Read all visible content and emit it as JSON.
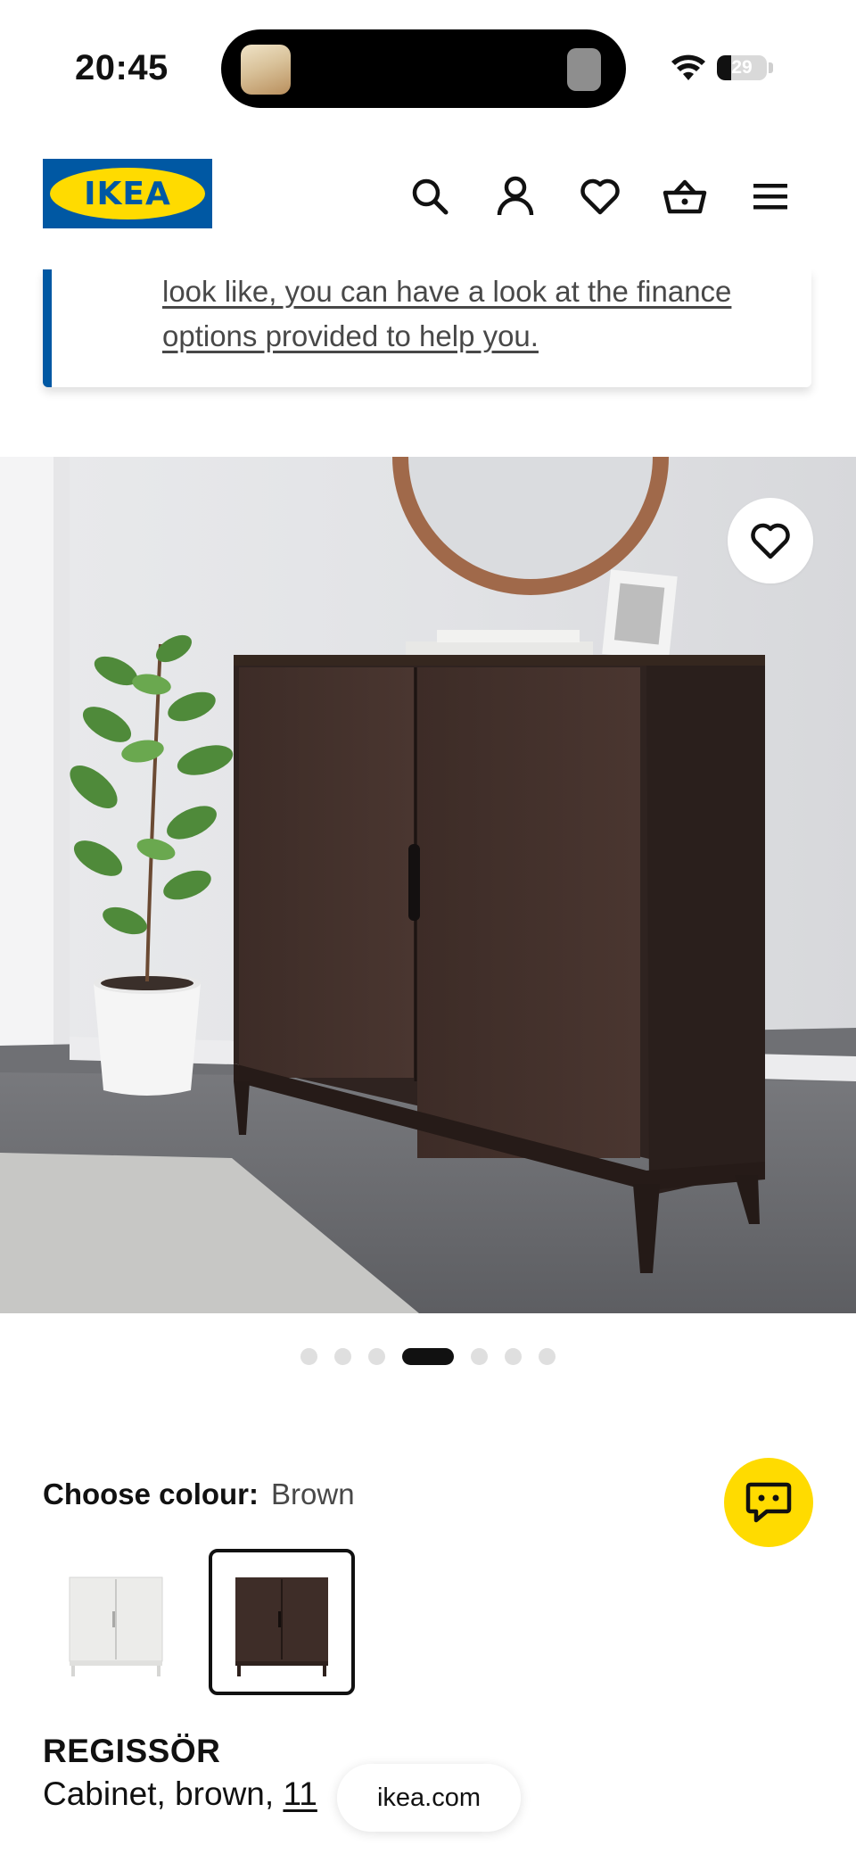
{
  "status_bar": {
    "time": "20:45",
    "battery_level": "29",
    "battery_fraction": 0.29,
    "icons": [
      "now-playing-thumbnail",
      "wifi-icon",
      "battery-icon"
    ]
  },
  "header": {
    "logo_text": "IKEA",
    "brand_colors": {
      "blue": "#0058a3",
      "yellow": "#ffdb00"
    },
    "icons": [
      "search-icon",
      "profile-icon",
      "heart-icon",
      "basket-icon",
      "menu-icon"
    ]
  },
  "finance_message": {
    "text": "look like, you can have a look at the finance options provided to help you.",
    "accent_color": "#0058a3"
  },
  "gallery": {
    "image_count": 7,
    "active_index": 3,
    "favourite_icon": "heart-icon"
  },
  "colour_chooser": {
    "label": "Choose colour:",
    "selected": "Brown",
    "swatches": [
      "white-cabinet-swatch",
      "brown-cabinet-swatch"
    ],
    "chat_icon": "chat-bubble-icon",
    "chat_color": "#ffdb00"
  },
  "product": {
    "name": "REGISSÖR",
    "description_prefix": "Cabinet, brown,",
    "measure_visible": "11"
  },
  "browser": {
    "url": "ikea.com"
  }
}
